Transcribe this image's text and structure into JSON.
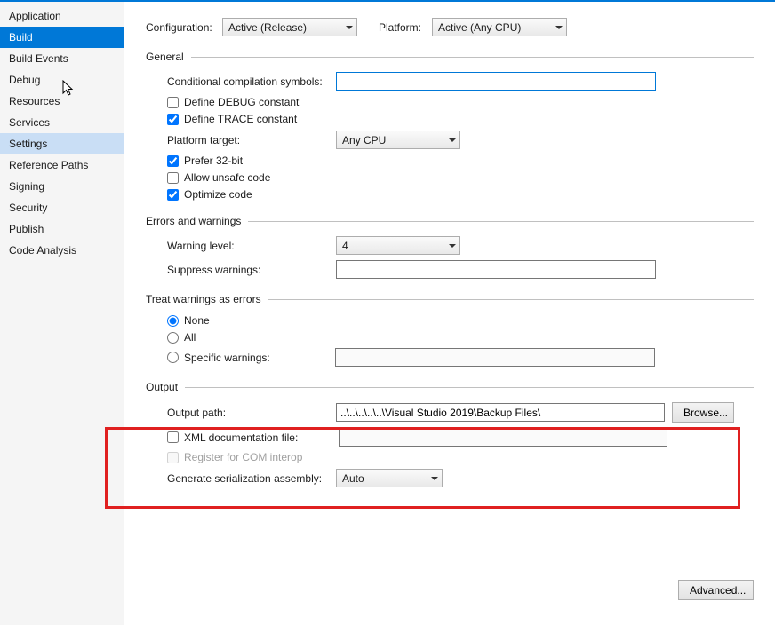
{
  "sidebar": {
    "items": [
      {
        "label": "Application"
      },
      {
        "label": "Build",
        "active": true
      },
      {
        "label": "Build Events"
      },
      {
        "label": "Debug"
      },
      {
        "label": "Resources"
      },
      {
        "label": "Services"
      },
      {
        "label": "Settings",
        "hover": true
      },
      {
        "label": "Reference Paths"
      },
      {
        "label": "Signing"
      },
      {
        "label": "Security"
      },
      {
        "label": "Publish"
      },
      {
        "label": "Code Analysis"
      }
    ]
  },
  "config": {
    "configuration_label": "Configuration:",
    "configuration_value": "Active (Release)",
    "platform_label": "Platform:",
    "platform_value": "Active (Any CPU)"
  },
  "sections": {
    "general": "General",
    "errors": "Errors and warnings",
    "treat": "Treat warnings as errors",
    "output": "Output"
  },
  "general": {
    "cond_symbols_label": "Conditional compilation symbols:",
    "cond_symbols_value": "",
    "define_debug": "Define DEBUG constant",
    "define_trace": "Define TRACE constant",
    "platform_target_label": "Platform target:",
    "platform_target_value": "Any CPU",
    "prefer_32": "Prefer 32-bit",
    "allow_unsafe": "Allow unsafe code",
    "optimize_code": "Optimize code"
  },
  "errors": {
    "warning_level_label": "Warning level:",
    "warning_level_value": "4",
    "suppress_label": "Suppress warnings:",
    "suppress_value": ""
  },
  "treat": {
    "none": "None",
    "all": "All",
    "specific": "Specific warnings:",
    "specific_value": ""
  },
  "output": {
    "output_path_label": "Output path:",
    "output_path_value": "..\\..\\..\\..\\..\\Visual Studio 2019\\Backup Files\\",
    "browse": "Browse...",
    "xml_doc": "XML documentation file:",
    "xml_doc_value": "",
    "register_com": "Register for COM interop",
    "serialization_label": "Generate serialization assembly:",
    "serialization_value": "Auto"
  },
  "advanced": "Advanced..."
}
